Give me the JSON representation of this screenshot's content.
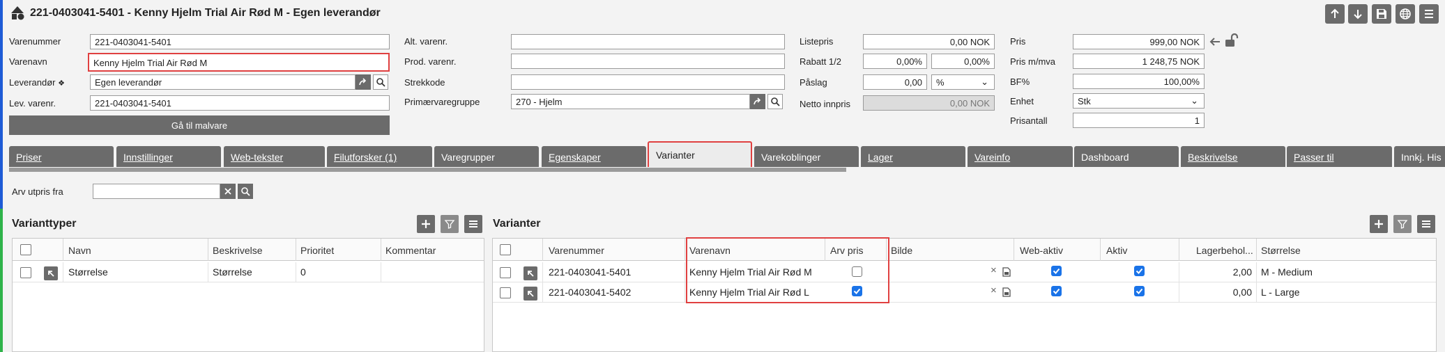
{
  "header": {
    "title": "221-0403041-5401 - Kenny Hjelm Trial Air Rød M - Egen leverandør"
  },
  "fields": {
    "varenummer_label": "Varenummer",
    "varenummer": "221-0403041-5401",
    "varenavn_label": "Varenavn",
    "varenavn": "Kenny Hjelm Trial Air Rød M",
    "leverandor_label": "Leverandør",
    "leverandor": "Egen leverandør",
    "levvarenr_label": "Lev. varenr.",
    "levvarenr": "221-0403041-5401",
    "malvare_button": "Gå til malvare",
    "altvarenr_label": "Alt. varenr.",
    "altvarenr": "",
    "prodvarenr_label": "Prod. varenr.",
    "prodvarenr": "",
    "strekkode_label": "Strekkode",
    "strekkode": "",
    "primaervaregruppe_label": "Primærvaregruppe",
    "primaervaregruppe": "270 - Hjelm",
    "listepris_label": "Listepris",
    "listepris": "0,00 NOK",
    "rabatt_label": "Rabatt 1/2",
    "rabatt1": "0,00%",
    "rabatt2": "0,00%",
    "paslag_label": "Påslag",
    "paslag": "0,00",
    "paslag_unit": "%",
    "netto_label": "Netto innpris",
    "netto": "0,00 NOK",
    "pris_label": "Pris",
    "pris": "999,00 NOK",
    "prismva_label": "Pris m/mva",
    "prismva": "1 248,75 NOK",
    "bf_label": "BF%",
    "bf": "100,00%",
    "enhet_label": "Enhet",
    "enhet": "Stk",
    "prisantall_label": "Prisantall",
    "prisantall": "1"
  },
  "tabs": [
    {
      "label": "Priser"
    },
    {
      "label": "Innstillinger"
    },
    {
      "label": "Web-tekster"
    },
    {
      "label": "Filutforsker (1)"
    },
    {
      "label": "Varegrupper"
    },
    {
      "label": "Egenskaper"
    },
    {
      "label": "Varianter"
    },
    {
      "label": "Varekoblinger"
    },
    {
      "label": "Lager"
    },
    {
      "label": "Vareinfo"
    },
    {
      "label": "Dashboard"
    },
    {
      "label": "Beskrivelse"
    },
    {
      "label": "Passer til"
    },
    {
      "label": "Innkj. His"
    }
  ],
  "arv": {
    "label": "Arv utpris fra",
    "value": ""
  },
  "varianttyper": {
    "title": "Varianttyper",
    "columns": [
      "Navn",
      "Beskrivelse",
      "Prioritet",
      "Kommentar"
    ],
    "rows": [
      {
        "navn": "Størrelse",
        "beskrivelse": "Størrelse",
        "prioritet": "0",
        "kommentar": ""
      }
    ]
  },
  "varianter": {
    "title": "Varianter",
    "columns": [
      "Varenummer",
      "Varenavn",
      "Arv pris",
      "Bilde",
      "Web-aktiv",
      "Aktiv",
      "Lagerbehol...",
      "Størrelse"
    ],
    "rows": [
      {
        "varenummer": "221-0403041-5401",
        "varenavn": "Kenny Hjelm Trial Air Rød M",
        "arv_pris": false,
        "web_aktiv": true,
        "aktiv": true,
        "lager": "2,00",
        "storrelse": "M - Medium"
      },
      {
        "varenummer": "221-0403041-5402",
        "varenavn": "Kenny Hjelm Trial Air Rød L",
        "arv_pris": true,
        "web_aktiv": true,
        "aktiv": true,
        "lager": "0,00",
        "storrelse": "L - Large"
      }
    ]
  },
  "colors": {
    "accent": "#6b6b6b",
    "highlight": "#e04040",
    "checkbox": "#1a73e8",
    "leftbar": "#1e5bd6"
  }
}
